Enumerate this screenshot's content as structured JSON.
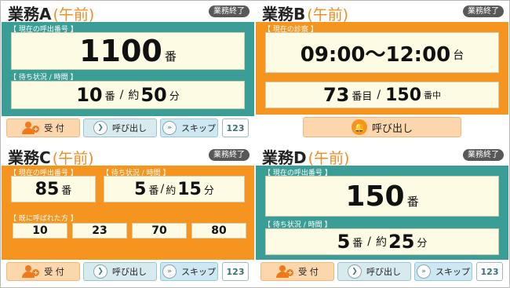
{
  "end_label": "業務終了",
  "panels": {
    "a": {
      "name": "業務A",
      "period": "(午前)",
      "current_label": "【 現在の呼出番号 】",
      "current_number": "1100",
      "current_unit": "番",
      "status_label": "【 待ち状況 / 時間 】",
      "wait_count": "10",
      "wait_count_unit": "番",
      "separator": "/",
      "wait_time_prefix": "約",
      "wait_time": "50",
      "wait_time_unit": "分"
    },
    "b": {
      "name": "業務B",
      "period": "(午前)",
      "current_label": "【 現在の診察 】",
      "time_range": "09:00〜12:00",
      "time_range_unit": "台",
      "current_order": "73",
      "current_order_unit": "番目",
      "separator": "/",
      "in_progress": "150",
      "in_progress_unit": "番中",
      "call_label": "呼び出し"
    },
    "c": {
      "name": "業務C",
      "period": "(午前)",
      "current_label": "【 現在の呼出番号 】",
      "current_number": "85",
      "current_unit": "番",
      "status_label": "【 待ち状況 / 時間 】",
      "wait_count": "5",
      "wait_count_unit": "番",
      "separator": "/",
      "wait_time_prefix": "約",
      "wait_time": "15",
      "wait_time_unit": "分",
      "history_label": "【 既に呼ばれた方 】",
      "history": [
        "10",
        "23",
        "70",
        "80"
      ]
    },
    "d": {
      "name": "業務D",
      "period": "(午前)",
      "current_label": "【 現在の呼出番号 】",
      "current_number": "150",
      "current_unit": "番",
      "status_label": "【 待ち状況 / 時間 】",
      "wait_count": "5",
      "wait_count_unit": "番",
      "separator": "/",
      "wait_time_prefix": "約",
      "wait_time": "25",
      "wait_time_unit": "分"
    }
  },
  "buttons": {
    "reception": "受 付",
    "call": "呼び出し",
    "skip": "スキップ",
    "number": "123",
    "call_glyph": "❯",
    "skip_glyph": "»",
    "bell_glyph": "🔔",
    "plus_glyph": "+"
  },
  "colors": {
    "teal": "#3a9e96",
    "orange": "#f5941f",
    "accent_text": "#f28c1e"
  }
}
